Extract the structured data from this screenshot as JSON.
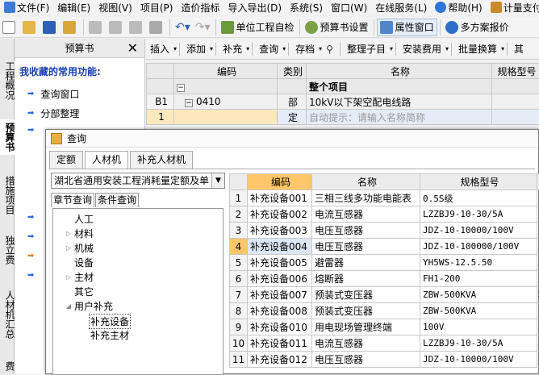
{
  "menubar": {
    "items": [
      "文件(F)",
      "编辑(E)",
      "视图(V)",
      "项目(P)",
      "造价指标",
      "导入导出(D)",
      "系统(S)",
      "窗口(W)",
      "在线服务(L)",
      "帮助(H)",
      "计量支付"
    ]
  },
  "toolbar": {
    "unit_check": "单位工程自检",
    "budget_settings": "预算书设置",
    "attr_window": "属性窗口",
    "multi_report": "多方案报价"
  },
  "vtabs": [
    "工程概况",
    "预算书",
    "措施项目",
    "独立费",
    "人材机汇总",
    "费"
  ],
  "left_panel": {
    "title": "预算书",
    "fav_title": "我收藏的常用功能:",
    "items": [
      "查询窗口",
      "分部整理"
    ]
  },
  "right_toolbar": [
    "插入",
    "添加",
    "补充",
    "查询",
    "存档",
    "整理子目",
    "安装费用",
    "批量换算",
    "其"
  ],
  "main_table": {
    "headers": [
      "编码",
      "类别",
      "名称",
      "规格型号"
    ],
    "rows": [
      {
        "rn": "",
        "code": "",
        "type": "",
        "name": "整个项目"
      },
      {
        "rn": "B1",
        "code": "0410",
        "type": "部",
        "name": "10kV以下架空配电线路"
      },
      {
        "rn": "1",
        "code": "",
        "type": "定",
        "name": "自动提示：请输入名称简称"
      }
    ]
  },
  "dialog": {
    "title": "查询",
    "tabs": [
      "定额",
      "人材机",
      "补充人材机"
    ],
    "combo": "湖北省通用安装工程消耗量定额及单",
    "subtabs": [
      "章节查询",
      "条件查询"
    ],
    "tree": [
      "人工",
      "材料",
      "机械",
      "设备",
      "主材",
      "其它",
      "用户补充",
      "补充设备",
      "补充主材"
    ],
    "grid_headers": [
      "编码",
      "名称",
      "规格型号"
    ],
    "rows": [
      {
        "n": "1",
        "code": "补充设备001",
        "name": "三相三线多功能电能表",
        "spec": "0.5S级"
      },
      {
        "n": "2",
        "code": "补充设备002",
        "name": "电流互感器",
        "spec": "LZZBJ9-10-30/5A"
      },
      {
        "n": "3",
        "code": "补充设备003",
        "name": "电压互感器",
        "spec": "JDZ-10-10000/100V"
      },
      {
        "n": "4",
        "code": "补充设备004",
        "name": "电压互感器",
        "spec": "JDZ-10-100000/100V"
      },
      {
        "n": "5",
        "code": "补充设备005",
        "name": "避雷器",
        "spec": "YH5WS-12.5.50"
      },
      {
        "n": "6",
        "code": "补充设备006",
        "name": "熔断器",
        "spec": "FH1-200"
      },
      {
        "n": "7",
        "code": "补充设备007",
        "name": "预装式变压器",
        "spec": "ZBW-500KVA",
        "extra": "1"
      },
      {
        "n": "8",
        "code": "补充设备008",
        "name": "预装式变压器",
        "spec": "ZBW-500KVA"
      },
      {
        "n": "9",
        "code": "补充设备010",
        "name": "用电现场管理终端",
        "spec": "100V"
      },
      {
        "n": "10",
        "code": "补充设备011",
        "name": "电流互感器",
        "spec": "LZZBJ9-10-30/5A"
      },
      {
        "n": "11",
        "code": "补充设备012",
        "name": "电压互感器",
        "spec": "JDZ-10-10000/100V"
      }
    ]
  }
}
